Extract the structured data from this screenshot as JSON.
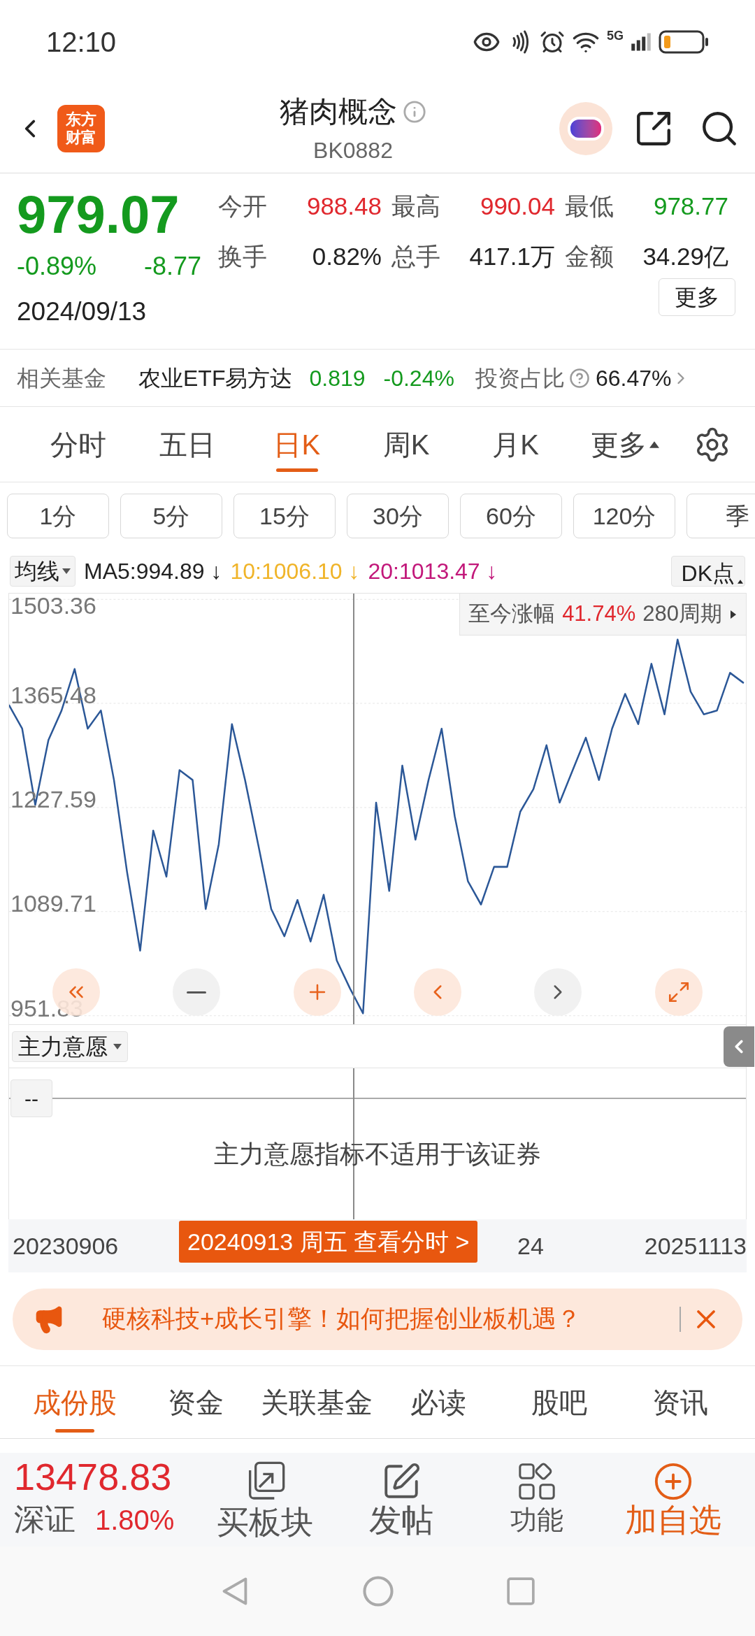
{
  "status_bar": {
    "time": "12:10",
    "network": "5G"
  },
  "header": {
    "logo_lines": [
      "东方",
      "财富"
    ],
    "title": "猪肉概念",
    "code": "BK0882"
  },
  "quote": {
    "price": "979.07",
    "change_pct": "-0.89%",
    "change": "-8.77",
    "color": "#149a1e",
    "date": "2024/09/13",
    "more_button": "更多",
    "stats": [
      {
        "label": "今开",
        "value": "988.48",
        "color": "#e0282e"
      },
      {
        "label": "最高",
        "value": "990.04",
        "color": "#e0282e"
      },
      {
        "label": "最低",
        "value": "978.77",
        "color": "#149a1e"
      },
      {
        "label": "换手",
        "value": "0.82%",
        "color": "#222222"
      },
      {
        "label": "总手",
        "value": "417.1万",
        "color": "#222222"
      },
      {
        "label": "金额",
        "value": "34.29亿",
        "color": "#222222"
      }
    ]
  },
  "related_fund": {
    "label": "相关基金",
    "name": "农业ETF易方达",
    "price": "0.819",
    "change": "-0.24%",
    "color": "#149a1e",
    "ratio_label": "投资占比",
    "ratio": "66.47%"
  },
  "period_tabs": [
    {
      "label": "分时",
      "selected": false
    },
    {
      "label": "五日",
      "selected": false
    },
    {
      "label": "日K",
      "selected": true
    },
    {
      "label": "周K",
      "selected": false
    },
    {
      "label": "月K",
      "selected": false
    },
    {
      "label": "更多",
      "selected": false
    }
  ],
  "minute_chips": [
    "1分",
    "5分",
    "15分",
    "30分",
    "60分",
    "120分",
    "季"
  ],
  "ma_bar": {
    "selector": "均线",
    "items": [
      {
        "text": "MA5:994.89 ↓",
        "color": "#222222"
      },
      {
        "text": "10:1006.10 ↓",
        "color": "#f0b429"
      },
      {
        "text": "20:1013.47 ↓",
        "color": "#c2187a"
      }
    ],
    "dk_button": "DK点"
  },
  "chart": {
    "gain_label": "至今涨幅",
    "gain_value": "41.74%",
    "period": "280周期",
    "chart_data": {
      "type": "line",
      "grid": true,
      "ylim": [
        951.83,
        1503.36
      ],
      "yticks": [
        {
          "value": 1503.36,
          "label": "1503.36"
        },
        {
          "value": 1365.48,
          "label": "1365.48"
        },
        {
          "value": 1227.59,
          "label": "1227.59"
        },
        {
          "value": 1089.71,
          "label": "1089.71"
        },
        {
          "value": 951.83,
          "label": "951.83"
        }
      ],
      "series": [
        {
          "color": "#2b5797",
          "values": [
            1363,
            1332,
            1231,
            1317,
            1356,
            1411,
            1332,
            1356,
            1264,
            1142,
            1038,
            1197,
            1136,
            1277,
            1264,
            1093,
            1179,
            1338,
            1264,
            1179,
            1093,
            1057,
            1105,
            1050,
            1112,
            1025,
            988,
            955,
            1234,
            1117,
            1283,
            1185,
            1264,
            1332,
            1216,
            1130,
            1099,
            1149,
            1149,
            1222,
            1252,
            1310,
            1234,
            1277,
            1320,
            1264,
            1332,
            1378,
            1338,
            1418,
            1351,
            1450,
            1381,
            1351,
            1356,
            1406,
            1393
          ]
        }
      ]
    },
    "controls": [
      {
        "disabled": false
      },
      {
        "disabled": true
      },
      {
        "disabled": false
      },
      {
        "disabled": false
      },
      {
        "disabled": true
      },
      {
        "disabled": false
      }
    ]
  },
  "indicator": {
    "selector": "主力意愿",
    "value": "--",
    "message": "主力意愿指标不适用于该证券"
  },
  "date_axis": {
    "start": "20230906",
    "middle": "24",
    "end": "20251113",
    "cursor_label": "20240913 周五 查看分时 >"
  },
  "banner": {
    "text": "硬核科技+成长引擎！如何把握创业板机遇？"
  },
  "bottom_tabs": [
    {
      "label": "成份股",
      "selected": true
    },
    {
      "label": "资金",
      "selected": false
    },
    {
      "label": "关联基金",
      "selected": false
    },
    {
      "label": "必读",
      "selected": false
    },
    {
      "label": "股吧",
      "selected": false
    },
    {
      "label": "资讯",
      "selected": false
    }
  ],
  "toolbar": {
    "index_value": "13478.83",
    "index_name": "深证",
    "index_change": "1.80%",
    "color": "#e0282e",
    "actions": [
      {
        "label": "买板块",
        "highlighted": false
      },
      {
        "label": "发帖",
        "highlighted": false
      },
      {
        "label": "功能",
        "highlighted": false
      },
      {
        "label": "加自选",
        "highlighted": true
      }
    ]
  }
}
